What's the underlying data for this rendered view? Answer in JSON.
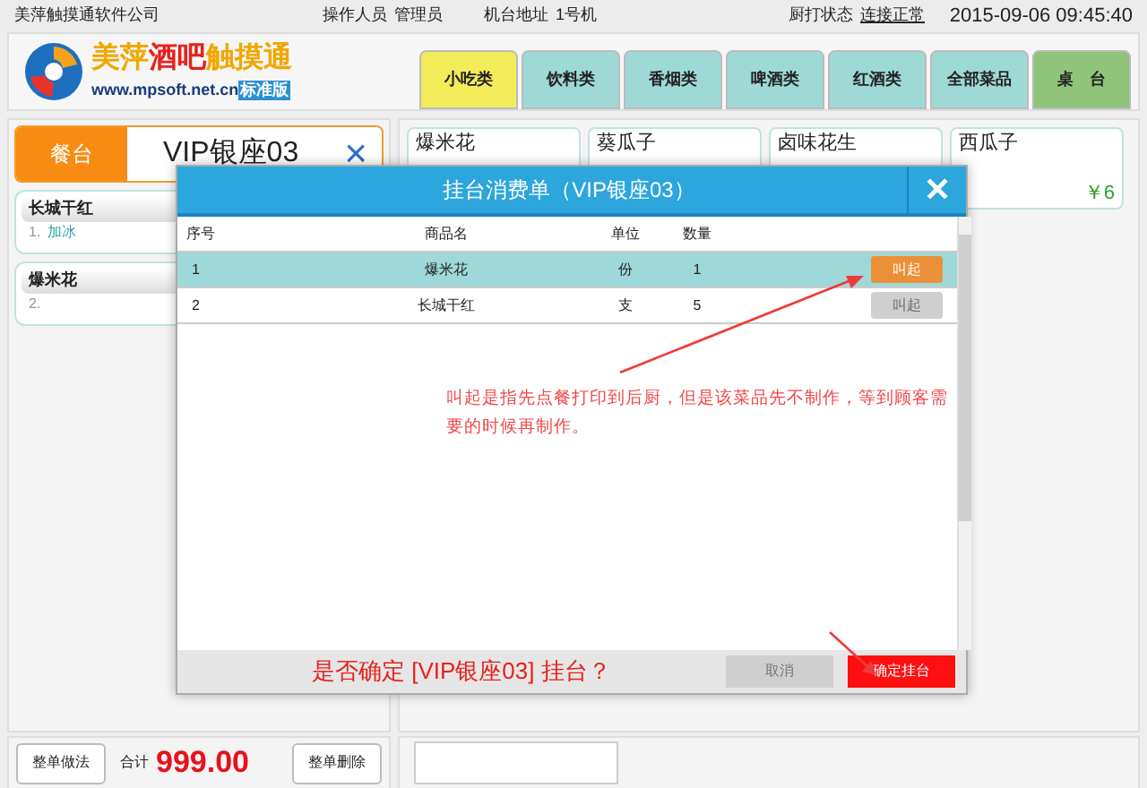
{
  "top_bar": {
    "company": "美萍触摸通软件公司",
    "operator_label": "操作人员",
    "operator": "管理员",
    "terminal_label": "机台地址",
    "terminal": "1号机",
    "printer_label": "厨打状态",
    "printer_status": "连接正常",
    "datetime": "2015-09-06 09:45:40"
  },
  "logo": {
    "title_parts": [
      {
        "text": "美萍",
        "color": "#f0a800"
      },
      {
        "text": "酒吧",
        "color": "#e8201c"
      },
      {
        "text": "触摸通",
        "color": "#f0a800"
      }
    ],
    "url": "www.mpsoft.net.cn",
    "edition": "标准版"
  },
  "tabs": [
    {
      "label": "小吃类",
      "kind": "category",
      "selected": true
    },
    {
      "label": "饮料类",
      "kind": "category",
      "selected": false
    },
    {
      "label": "香烟类",
      "kind": "category",
      "selected": false
    },
    {
      "label": "啤酒类",
      "kind": "category",
      "selected": false
    },
    {
      "label": "红酒类",
      "kind": "category",
      "selected": false
    },
    {
      "label": "全部菜品",
      "kind": "category",
      "selected": false
    },
    {
      "label": "桌　台",
      "kind": "table",
      "selected": false
    }
  ],
  "table_header": {
    "label": "餐台",
    "table_name": "VIP银座03",
    "close": "×"
  },
  "order_items": [
    {
      "name": "长城干红",
      "note": "1.",
      "note_text": "加冰"
    },
    {
      "name": "爆米花",
      "note": "2."
    }
  ],
  "products": [
    {
      "name": "爆米花"
    },
    {
      "name": "葵瓜子"
    },
    {
      "name": "卤味花生"
    },
    {
      "name": "西瓜子",
      "price": "￥6"
    }
  ],
  "bottom": {
    "method_button": "整单做法",
    "total_label": "合计",
    "total": "999.00",
    "delete_button": "整单删除"
  },
  "dialog": {
    "title": "挂台消费单（VIP银座03）",
    "close": "✕",
    "columns": [
      "序号",
      "商品名",
      "单位",
      "数量"
    ],
    "rows": [
      {
        "no": "1",
        "name": "爆米花",
        "unit": "份",
        "qty": "1",
        "action": "叫起",
        "selected": true,
        "action_enabled": true
      },
      {
        "no": "2",
        "name": "长城干红",
        "unit": "支",
        "qty": "5",
        "action": "叫起",
        "selected": false,
        "action_enabled": false
      }
    ],
    "annotation": "叫起是指先点餐打印到后厨，但是该菜品先不制作，等到顾客需要的时候再制作。",
    "question": "是否确定 [VIP银座03] 挂台？",
    "cancel": "取消",
    "confirm": "确定挂台"
  }
}
